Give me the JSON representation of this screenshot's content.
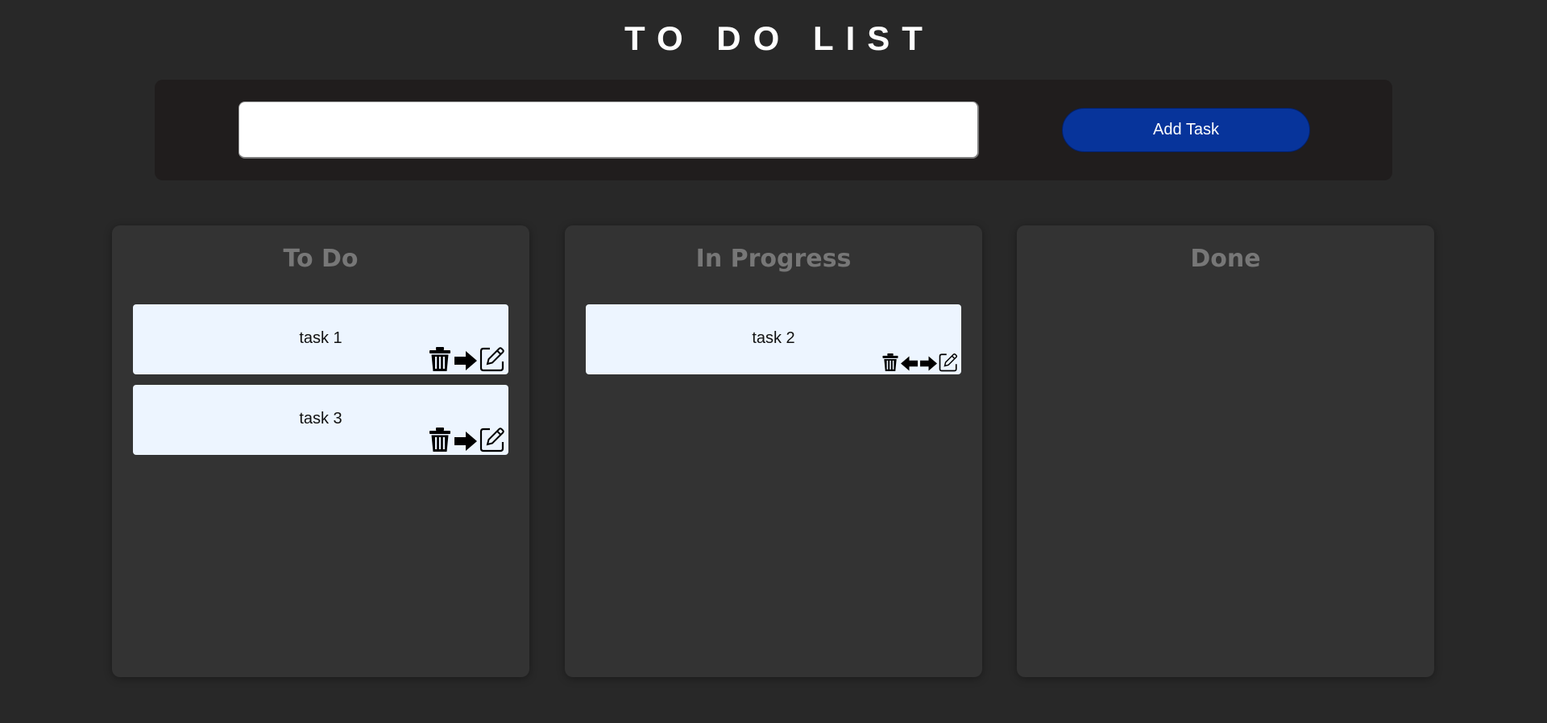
{
  "header": {
    "title": "TO DO LIST"
  },
  "task_entry": {
    "input_value": "",
    "placeholder": "",
    "add_label": "Add Task"
  },
  "columns": [
    {
      "title": "To Do",
      "tasks": [
        {
          "label": "task 1"
        },
        {
          "label": "task 3"
        }
      ]
    },
    {
      "title": "In Progress",
      "tasks": [
        {
          "label": "task 2"
        }
      ]
    },
    {
      "title": "Done",
      "tasks": []
    }
  ],
  "icons": {
    "delete": "trash-icon",
    "move_back": "arrow-left-icon",
    "move_forward": "arrow-right-icon",
    "edit": "edit-icon"
  },
  "colors": {
    "background": "#282828",
    "panel": "#201d1d",
    "column": "#333333",
    "card": "#edf5ff",
    "accent": "#07349b",
    "column_title": "#777777"
  }
}
